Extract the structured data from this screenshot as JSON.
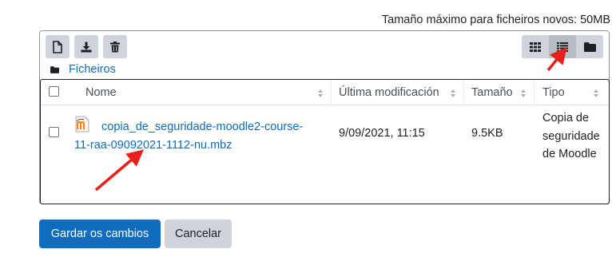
{
  "max_size_text": "Tamaño máximo para ficheiros novos: 50MB",
  "toolbar": {
    "create_file_icon": "file-icon",
    "download_icon": "download-icon",
    "delete_icon": "trash-icon"
  },
  "view_buttons": [
    {
      "icon": "grid-icon",
      "active": false
    },
    {
      "icon": "list-icon",
      "active": true
    },
    {
      "icon": "folder-tree-icon",
      "active": false
    }
  ],
  "path": {
    "folder_icon": "folder-icon",
    "label": "Ficheiros"
  },
  "table": {
    "headers": {
      "name": "Nome",
      "modified": "Última modificación",
      "size": "Tamaño",
      "type": "Tipo"
    },
    "rows": [
      {
        "icon": "moodle-backup-icon",
        "name_line1": "copia_de_seguridade-moodle2-course-",
        "name_line2": "11-raa-09092021-1112-nu.mbz",
        "modified": "9/09/2021, 11:15",
        "size": "9.5KB",
        "type_line1": "Copia de",
        "type_line2": "seguridade",
        "type_line3": "de Moodle"
      }
    ]
  },
  "buttons": {
    "save": "Gardar os cambios",
    "cancel": "Cancelar"
  },
  "colors": {
    "primary": "#0f6cbf",
    "secondary": "#ced4da",
    "annotation_arrow": "#e8201c"
  }
}
